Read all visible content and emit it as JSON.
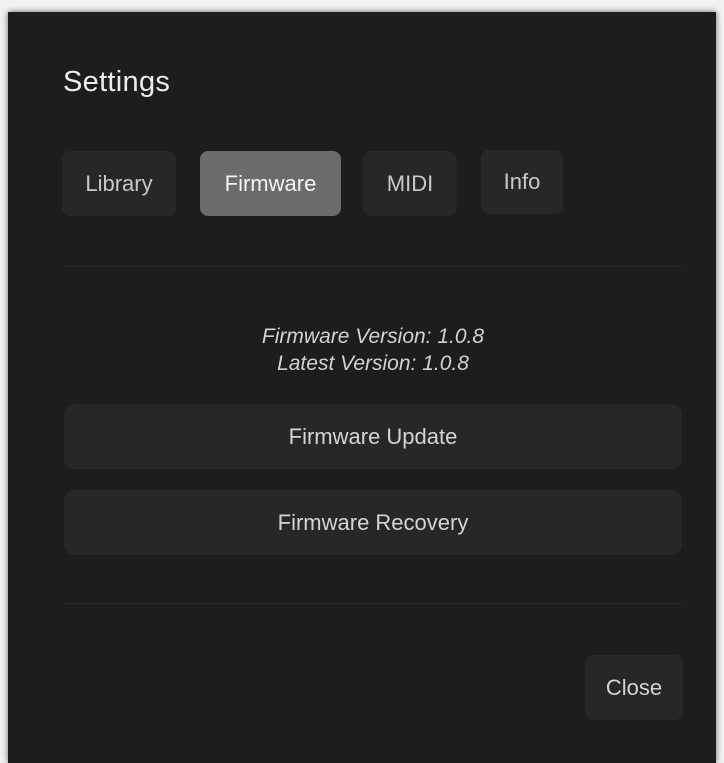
{
  "dialog": {
    "title": "Settings"
  },
  "tabs": [
    {
      "label": "Library",
      "active": false
    },
    {
      "label": "Firmware",
      "active": true
    },
    {
      "label": "MIDI",
      "active": false
    },
    {
      "label": "Info",
      "active": false
    }
  ],
  "firmware": {
    "current_version": "Firmware Version: 1.0.8",
    "latest_version": "Latest Version: 1.0.8",
    "update_label": "Firmware Update",
    "recovery_label": "Firmware Recovery"
  },
  "footer": {
    "close_label": "Close"
  },
  "colors": {
    "dialog_bg": "#1d1d1d",
    "button_bg": "#272727",
    "active_tab_bg": "#6b6b6b",
    "text": "#d4d4d4"
  }
}
